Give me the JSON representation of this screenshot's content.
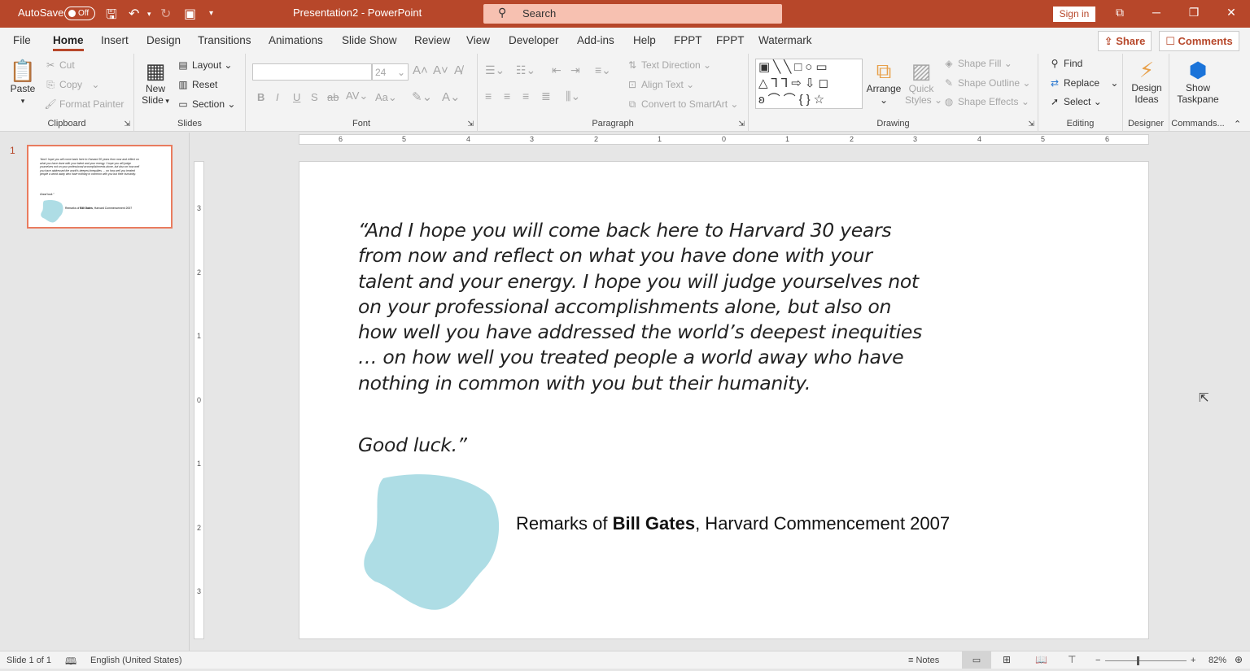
{
  "titlebar": {
    "autosave_label": "AutoSave",
    "autosave_state": "Off",
    "window_title": "Presentation2  -  PowerPoint",
    "search_placeholder": "Search",
    "sign_in": "Sign in",
    "color": "#b7472a"
  },
  "tabs": [
    "File",
    "Home",
    "Insert",
    "Design",
    "Transitions",
    "Animations",
    "Slide Show",
    "Review",
    "View",
    "Developer",
    "Add-ins",
    "Help",
    "FPPT",
    "FPPT",
    "Watermark"
  ],
  "active_tab": "Home",
  "actions": {
    "share": "Share",
    "comments": "Comments"
  },
  "ribbon": {
    "clipboard": {
      "label": "Clipboard",
      "paste": "Paste",
      "cut": "Cut",
      "copy": "Copy",
      "format_painter": "Format Painter"
    },
    "slides": {
      "label": "Slides",
      "new_slide_1": "New",
      "new_slide_2": "Slide",
      "layout": "Layout",
      "reset": "Reset",
      "section": "Section"
    },
    "font": {
      "label": "Font",
      "font_name": "",
      "font_size": "24"
    },
    "paragraph": {
      "label": "Paragraph",
      "text_direction": "Text Direction",
      "align_text": "Align Text",
      "convert_smartart": "Convert to SmartArt"
    },
    "drawing": {
      "label": "Drawing",
      "arrange": "Arrange",
      "quick_styles_1": "Quick",
      "quick_styles_2": "Styles",
      "shape_fill": "Shape Fill",
      "shape_outline": "Shape Outline",
      "shape_effects": "Shape Effects"
    },
    "editing": {
      "label": "Editing",
      "find": "Find",
      "replace": "Replace",
      "select": "Select"
    },
    "designer": {
      "label": "Designer",
      "design_ideas_1": "Design",
      "design_ideas_2": "Ideas"
    },
    "commands": {
      "label": "Commands...",
      "show_taskpane_1": "Show",
      "show_taskpane_2": "Taskpane"
    }
  },
  "thumbnail": {
    "number": "1"
  },
  "rulers": {
    "horizontal": [
      "6",
      "5",
      "4",
      "3",
      "2",
      "1",
      "0",
      "1",
      "2",
      "3",
      "4",
      "5",
      "6"
    ],
    "vertical": [
      "3",
      "2",
      "1",
      "0",
      "1",
      "2",
      "3"
    ]
  },
  "slide": {
    "quote": "“And I hope you will come back here to Harvard 30 years from now and reflect on what you have done with your talent and your energy. I hope you will judge yourselves not on your professional accomplishments alone, but also on how well you have addressed the world’s deepest inequities … on how well you treated people a world away who have nothing in common with you but their humanity.",
    "good_luck": "Good luck.”",
    "caption_prefix": "Remarks of ",
    "caption_name": "Bill Gates",
    "caption_suffix": ", Harvard Commencement 2007",
    "blob_color": "#aeddE5"
  },
  "status": {
    "slide_info": "Slide 1 of 1",
    "language": "English (United States)",
    "notes": "Notes",
    "zoom": "82%"
  }
}
